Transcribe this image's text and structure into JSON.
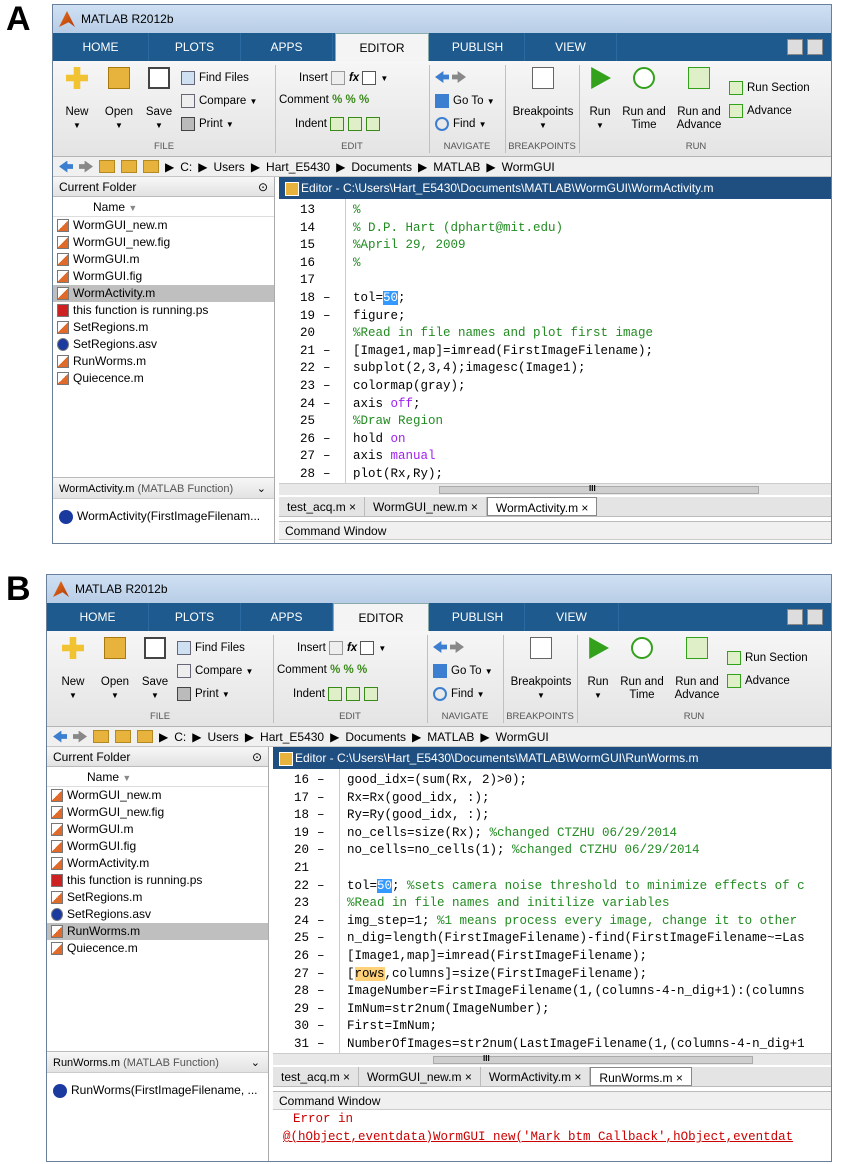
{
  "labels": {
    "a": "A",
    "b": "B"
  },
  "app_title": "MATLAB R2012b",
  "tabs": [
    "HOME",
    "PLOTS",
    "APPS",
    "EDITOR",
    "PUBLISH",
    "VIEW"
  ],
  "ribbon": {
    "new": "New",
    "open": "Open",
    "save": "Save",
    "find_files": "Find Files",
    "compare": "Compare",
    "print": "Print",
    "insert": "Insert",
    "comment": "Comment",
    "indent": "Indent",
    "go_to": "Go To",
    "find": "Find",
    "breakpoints": "Breakpoints",
    "run": "Run",
    "run_and_time": "Run and\nTime",
    "run_and_advance": "Run and\nAdvance",
    "run_section": "Run Section",
    "advance": "Advance",
    "groups": {
      "file": "FILE",
      "edit": "EDIT",
      "navigate": "NAVIGATE",
      "breakpoints": "BREAKPOINTS",
      "run": "RUN"
    }
  },
  "path": [
    "C:",
    "Users",
    "Hart_E5430",
    "Documents",
    "MATLAB",
    "WormGUI"
  ],
  "current_folder": "Current Folder",
  "name_col": "Name",
  "files_a": [
    "WormGUI_new.m",
    "WormGUI_new.fig",
    "WormGUI.m",
    "WormGUI.fig",
    "WormActivity.m",
    "this function is running.ps",
    "SetRegions.m",
    "SetRegions.asv",
    "RunWorms.m",
    "Quiecence.m"
  ],
  "files_b": [
    "WormGUI_new.m",
    "WormGUI_new.fig",
    "WormGUI.m",
    "WormGUI.fig",
    "WormActivity.m",
    "this function is running.ps",
    "SetRegions.m",
    "SetRegions.asv",
    "RunWorms.m",
    "Quiecence.m"
  ],
  "a": {
    "editor_title": "Editor - C:\\Users\\Hart_E5430\\Documents\\MATLAB\\WormGUI\\WormActivity.m",
    "details_name": "WormActivity.m",
    "details_type": "(MATLAB Function)",
    "signature": "WormActivity(FirstImageFilenam...",
    "lines": [
      {
        "n": "13",
        "d": "",
        "parts": [
          {
            "t": "%",
            "c": "cm"
          }
        ]
      },
      {
        "n": "14",
        "d": "",
        "parts": [
          {
            "t": "% D.P. Hart (dphart@mit.edu)",
            "c": "cm"
          }
        ]
      },
      {
        "n": "15",
        "d": "",
        "parts": [
          {
            "t": "%April 29, 2009",
            "c": "cm"
          }
        ]
      },
      {
        "n": "16",
        "d": "",
        "parts": [
          {
            "t": "%",
            "c": "cm"
          }
        ]
      },
      {
        "n": "17",
        "d": "",
        "parts": [
          {
            "t": "",
            "c": ""
          }
        ]
      },
      {
        "n": "18",
        "d": "–",
        "parts": [
          {
            "t": "tol=",
            "c": ""
          },
          {
            "t": "50",
            "c": "hl"
          },
          {
            "t": ";",
            "c": ""
          }
        ]
      },
      {
        "n": "19",
        "d": "–",
        "parts": [
          {
            "t": "figure;",
            "c": ""
          }
        ]
      },
      {
        "n": "20",
        "d": "",
        "parts": [
          {
            "t": "%Read in file names and plot first image",
            "c": "cm"
          }
        ]
      },
      {
        "n": "21",
        "d": "–",
        "parts": [
          {
            "t": "[Image1,map]=imread(FirstImageFilename);",
            "c": ""
          }
        ]
      },
      {
        "n": "22",
        "d": "–",
        "parts": [
          {
            "t": "subplot(2,3,4);imagesc(Image1);",
            "c": ""
          }
        ]
      },
      {
        "n": "23",
        "d": "–",
        "parts": [
          {
            "t": "colormap(gray);",
            "c": ""
          }
        ]
      },
      {
        "n": "24",
        "d": "–",
        "parts": [
          {
            "t": "axis ",
            "c": ""
          },
          {
            "t": "off",
            "c": "kw"
          },
          {
            "t": ";",
            "c": ""
          }
        ]
      },
      {
        "n": "25",
        "d": "",
        "parts": [
          {
            "t": "%Draw Region",
            "c": "cm"
          }
        ]
      },
      {
        "n": "26",
        "d": "–",
        "parts": [
          {
            "t": "hold ",
            "c": ""
          },
          {
            "t": "on",
            "c": "kw"
          }
        ]
      },
      {
        "n": "27",
        "d": "–",
        "parts": [
          {
            "t": "axis ",
            "c": ""
          },
          {
            "t": "manual",
            "c": "kw"
          }
        ]
      },
      {
        "n": "28",
        "d": "–",
        "parts": [
          {
            "t": "plot(Rx,Ry);",
            "c": ""
          }
        ]
      }
    ],
    "file_tabs": [
      "test_acq.m",
      "WormGUI_new.m",
      "WormActivity.m"
    ],
    "command_window": "Command Window",
    "scroll_mark": "III"
  },
  "b": {
    "editor_title": "Editor - C:\\Users\\Hart_E5430\\Documents\\MATLAB\\WormGUI\\RunWorms.m",
    "details_name": "RunWorms.m",
    "details_type": "(MATLAB Function)",
    "signature": "RunWorms(FirstImageFilename, ...",
    "lines": [
      {
        "n": "16",
        "d": "–",
        "parts": [
          {
            "t": "good_idx=(sum(Rx, 2)>0);",
            "c": ""
          }
        ]
      },
      {
        "n": "17",
        "d": "–",
        "parts": [
          {
            "t": "Rx=Rx(good_idx, :);",
            "c": ""
          }
        ]
      },
      {
        "n": "18",
        "d": "–",
        "parts": [
          {
            "t": "Ry=Ry(good_idx, :);",
            "c": ""
          }
        ]
      },
      {
        "n": "19",
        "d": "–",
        "parts": [
          {
            "t": "no_cells=size(Rx); ",
            "c": ""
          },
          {
            "t": "%changed CTZHU 06/29/2014",
            "c": "cm"
          }
        ]
      },
      {
        "n": "20",
        "d": "–",
        "parts": [
          {
            "t": "no_cells=no_cells(1); ",
            "c": ""
          },
          {
            "t": "%changed CTZHU 06/29/2014",
            "c": "cm"
          }
        ]
      },
      {
        "n": "21",
        "d": "",
        "parts": [
          {
            "t": "",
            "c": ""
          }
        ]
      },
      {
        "n": "22",
        "d": "–",
        "parts": [
          {
            "t": "tol=",
            "c": ""
          },
          {
            "t": "50",
            "c": "hl"
          },
          {
            "t": "; ",
            "c": ""
          },
          {
            "t": "%sets camera noise threshold to minimize effects of c",
            "c": "cm"
          }
        ]
      },
      {
        "n": "23",
        "d": "",
        "parts": [
          {
            "t": "%Read in file names and initilize variables",
            "c": "cm"
          }
        ]
      },
      {
        "n": "24",
        "d": "–",
        "parts": [
          {
            "t": "img_step=1; ",
            "c": ""
          },
          {
            "t": "%1 means process every image, change it to other",
            "c": "cm"
          }
        ]
      },
      {
        "n": "25",
        "d": "–",
        "parts": [
          {
            "t": "n_dig=length(FirstImageFilename)-find(FirstImageFilename~=Las",
            "c": ""
          }
        ]
      },
      {
        "n": "26",
        "d": "–",
        "parts": [
          {
            "t": "[Image1,map]=imread(FirstImageFilename);",
            "c": ""
          }
        ]
      },
      {
        "n": "27",
        "d": "–",
        "parts": [
          {
            "t": "[",
            "c": ""
          },
          {
            "t": "rows",
            "c": "hs"
          },
          {
            "t": ",columns]=size(FirstImageFilename);",
            "c": ""
          }
        ]
      },
      {
        "n": "28",
        "d": "–",
        "parts": [
          {
            "t": "ImageNumber=FirstImageFilename(1,(columns-4-n_dig+1):(columns",
            "c": ""
          }
        ]
      },
      {
        "n": "29",
        "d": "–",
        "parts": [
          {
            "t": "ImNum=str2num(ImageNumber);",
            "c": ""
          }
        ]
      },
      {
        "n": "30",
        "d": "–",
        "parts": [
          {
            "t": "First=ImNum;",
            "c": ""
          }
        ]
      },
      {
        "n": "31",
        "d": "–",
        "parts": [
          {
            "t": "NumberOfImages=str2num(LastImageFilename(1,(columns-4-n_dig+1",
            "c": ""
          }
        ]
      }
    ],
    "file_tabs": [
      "test_acq.m",
      "WormGUI_new.m",
      "WormActivity.m",
      "RunWorms.m"
    ],
    "command_window": "Command Window",
    "error_line1": "Error in",
    "error_line2": "@(hObject,eventdata)WormGUI_new('Mark_btm_Callback',hObject,eventdat",
    "scroll_mark": "III"
  }
}
